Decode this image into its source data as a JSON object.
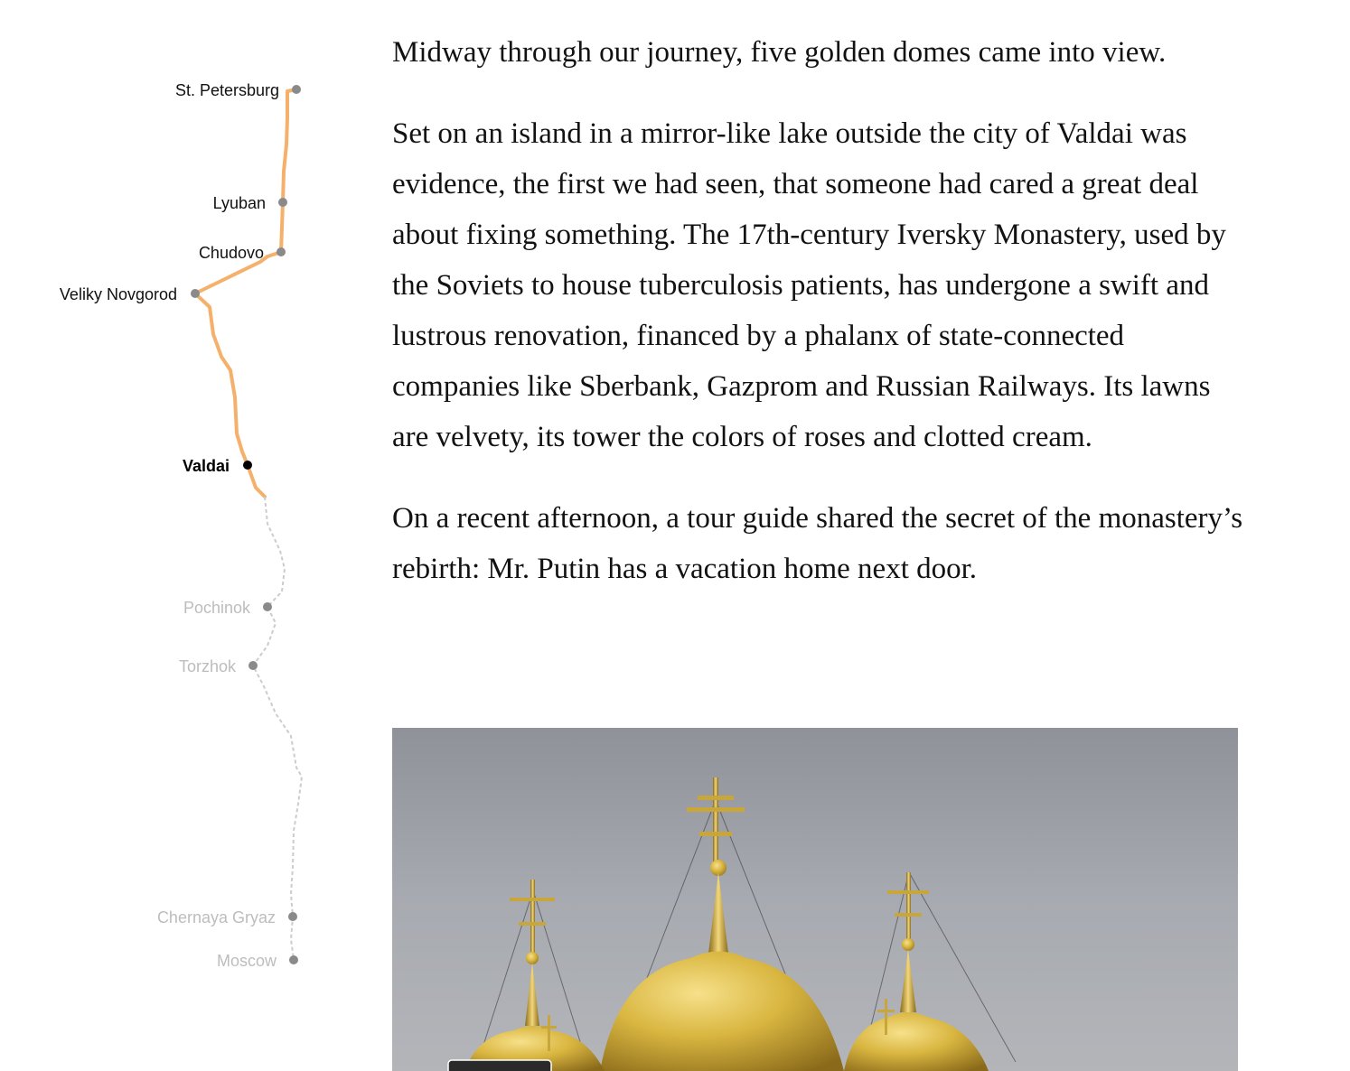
{
  "route": {
    "stops": [
      {
        "name": "St. Petersburg",
        "status": "visited"
      },
      {
        "name": "Lyuban",
        "status": "visited"
      },
      {
        "name": "Chudovo",
        "status": "visited"
      },
      {
        "name": "Veliky Novgorod",
        "status": "visited"
      },
      {
        "name": "Valdai",
        "status": "current"
      },
      {
        "name": "Pochinok",
        "status": "upcoming"
      },
      {
        "name": "Torzhok",
        "status": "upcoming"
      },
      {
        "name": "Chernaya Gryaz",
        "status": "upcoming"
      },
      {
        "name": "Moscow",
        "status": "upcoming"
      }
    ],
    "colors": {
      "traveled_line": "#f5b06b",
      "upcoming_line": "#cccccc",
      "stop_dot": "#8a8a8a",
      "current_dot": "#000000"
    }
  },
  "article": {
    "paragraphs": [
      "Midway through our journey, five golden domes came into view.",
      "Set on an island in a mirror-like lake outside the city of Valdai was evidence, the first we had seen, that someone had cared a great deal about fixing something. The 17th-century Iversky Monastery, used by the Soviets to house tuberculosis patients, has undergone a swift and lustrous renovation, financed by a phalanx of state-connected companies like Sberbank, Gazprom and Russian Railways. Its lawns are velvety, its tower the colors of roses and clotted cream.",
      "On a recent afternoon, a tour guide shared the secret of the monastery’s rebirth: Mr. Putin has a vacation home next door."
    ]
  },
  "photo": {
    "subject": "golden-onion-domes-with-crosses",
    "sky_color": "#9fa3aa",
    "dome_color": "#d9b640"
  }
}
